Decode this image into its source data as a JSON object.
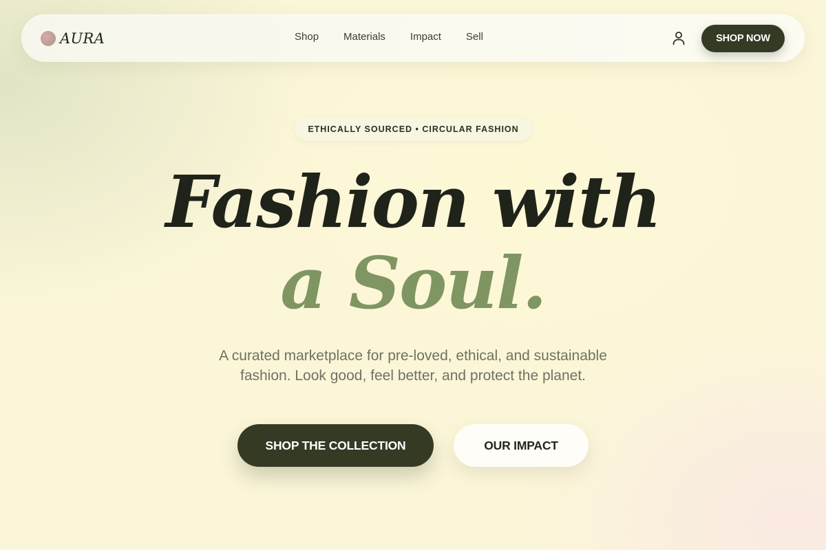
{
  "nav": {
    "logo_text": "AURA",
    "links": [
      "Shop",
      "Materials",
      "Impact",
      "Sell"
    ],
    "account_icon": "user-icon",
    "cta_label": "SHOP NOW"
  },
  "hero": {
    "badge": "ETHICALLY SOURCED • CIRCULAR FASHION",
    "headline_line1": "Fashion with",
    "headline_line2": "a Soul.",
    "subtext": "A curated marketplace for pre-loved, ethical, and sustainable fashion. Look good, feel better, and protect the planet.",
    "primary_button": "SHOP THE COLLECTION",
    "secondary_button": "OUR IMPACT"
  },
  "colors": {
    "dark_olive": "#343a24",
    "sage_accent": "#7f9562",
    "headline_dark": "#1f231a",
    "body_text": "#6f7262"
  }
}
